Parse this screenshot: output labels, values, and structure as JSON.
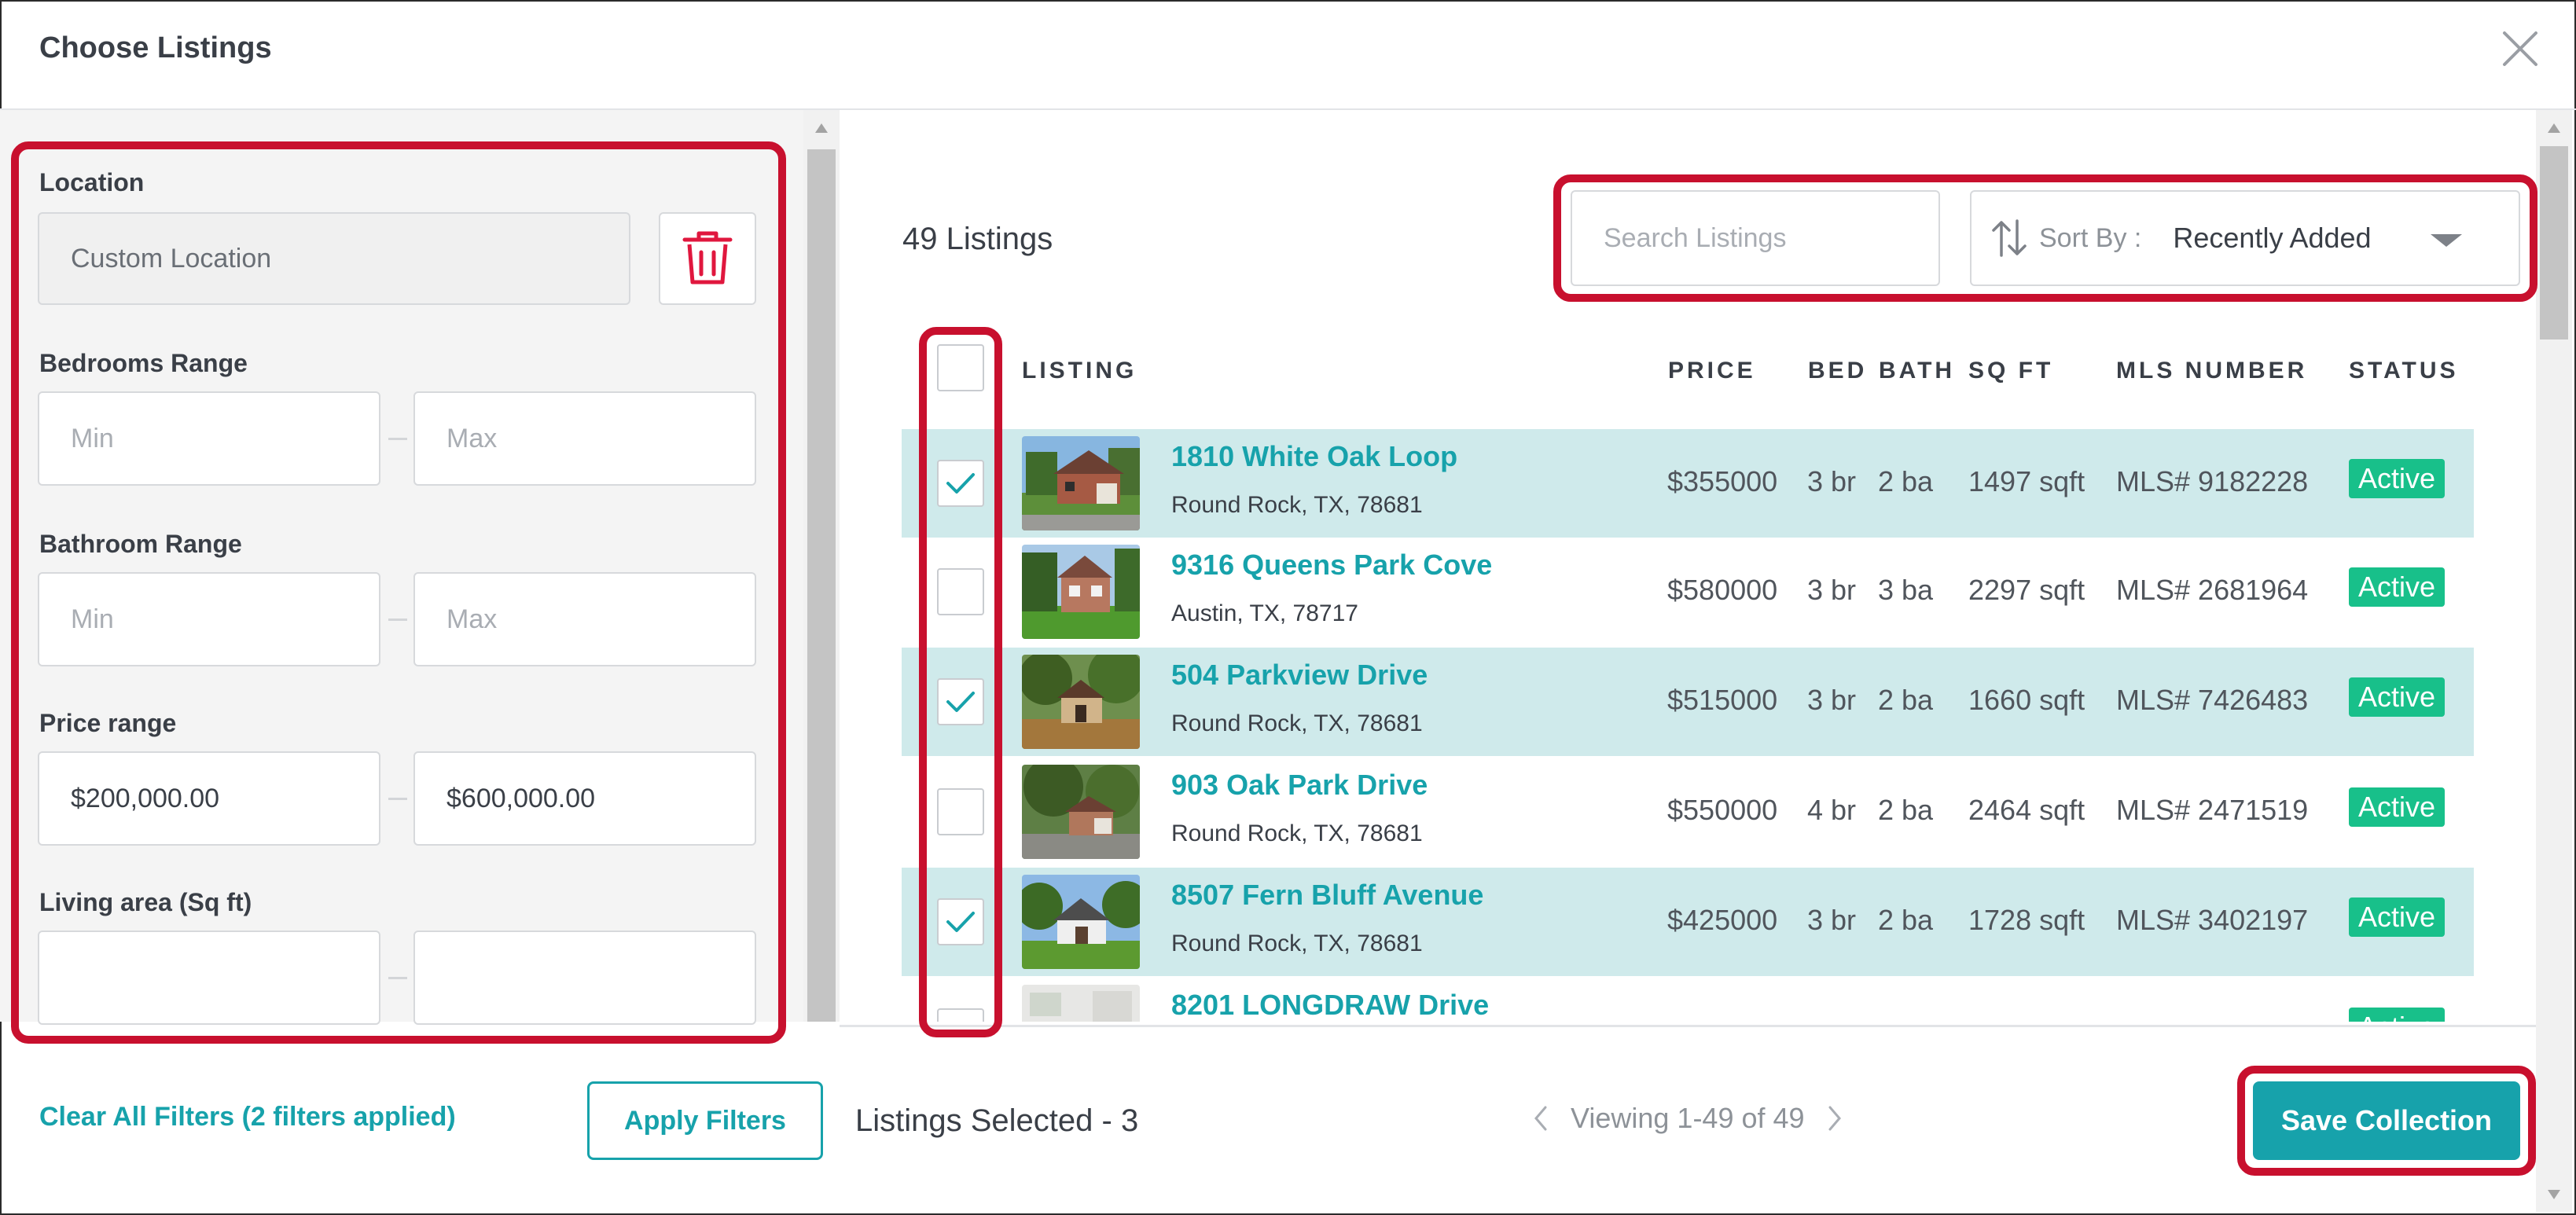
{
  "dialog": {
    "title": "Choose Listings"
  },
  "filters": {
    "location": {
      "label": "Location",
      "value": "Custom Location"
    },
    "bedrooms": {
      "label": "Bedrooms Range",
      "min_placeholder": "Min",
      "max_placeholder": "Max"
    },
    "bathrooms": {
      "label": "Bathroom Range",
      "min_placeholder": "Min",
      "max_placeholder": "Max"
    },
    "price": {
      "label": "Price range",
      "min_value": "$200,000.00",
      "max_value": "$600,000.00"
    },
    "living_area": {
      "label": "Living area (Sq ft)"
    },
    "clear_label": "Clear All Filters (2 filters applied)",
    "apply_label": "Apply Filters"
  },
  "listings": {
    "count_label": "49 Listings",
    "search_placeholder": "Search Listings",
    "sort_label": "Sort By :",
    "sort_value": "Recently Added",
    "columns": [
      "LISTING",
      "PRICE",
      "BED",
      "BATH",
      "SQ FT",
      "MLS NUMBER",
      "STATUS"
    ],
    "rows": [
      {
        "address": "1810 White Oak Loop",
        "city": "Round Rock, TX, 78681",
        "price": "$355000",
        "bed": "3 br",
        "bath": "2 ba",
        "sqft": "1497 sqft",
        "mls": "MLS# 9182228",
        "status": "Active",
        "selected": true
      },
      {
        "address": "9316 Queens Park Cove",
        "city": "Austin, TX, 78717",
        "price": "$580000",
        "bed": "3 br",
        "bath": "3 ba",
        "sqft": "2297 sqft",
        "mls": "MLS# 2681964",
        "status": "Active",
        "selected": false
      },
      {
        "address": "504 Parkview Drive",
        "city": "Round Rock, TX, 78681",
        "price": "$515000",
        "bed": "3 br",
        "bath": "2 ba",
        "sqft": "1660 sqft",
        "mls": "MLS# 7426483",
        "status": "Active",
        "selected": true
      },
      {
        "address": "903 Oak Park Drive",
        "city": "Round Rock, TX, 78681",
        "price": "$550000",
        "bed": "4 br",
        "bath": "2 ba",
        "sqft": "2464 sqft",
        "mls": "MLS# 2471519",
        "status": "Active",
        "selected": false
      },
      {
        "address": "8507 Fern Bluff Avenue",
        "city": "Round Rock, TX, 78681",
        "price": "$425000",
        "bed": "3 br",
        "bath": "2 ba",
        "sqft": "1728 sqft",
        "mls": "MLS# 3402197",
        "status": "Active",
        "selected": true
      },
      {
        "address": "8201 LONGDRAW Drive",
        "city": "",
        "price": "",
        "bed": "",
        "bath": "",
        "sqft": "",
        "mls": "",
        "status": "Active",
        "selected": false
      }
    ]
  },
  "footer": {
    "selected_label": "Listings Selected - 3",
    "viewing_label": "Viewing 1-49 of 49",
    "save_label": "Save Collection"
  },
  "colors": {
    "accent": "#17a2ab",
    "selected_row": "#cfeaeb",
    "status_active": "#18c08a",
    "annotation": "#c8102e"
  },
  "icons": [
    "close-icon",
    "trash-icon",
    "sort-icon",
    "chevron-down-icon",
    "check-icon",
    "chevron-left-icon",
    "chevron-right-icon"
  ]
}
